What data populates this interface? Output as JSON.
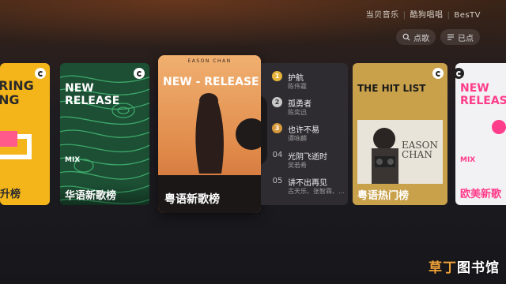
{
  "header": {
    "brand_1": "当贝音乐",
    "brand_2": "酷狗唱唱",
    "brand_3": "BesTV",
    "search_label": "点歌",
    "queue_label": "已点"
  },
  "cards": [
    {
      "title_lines": [
        "RING",
        "NG"
      ],
      "label": "升榜"
    },
    {
      "title_lines": [
        "NEW",
        "RELEASE"
      ],
      "mix": "MIX",
      "label": "华语新歌榜"
    },
    {
      "artist": "EASON CHAN",
      "title": "NEW - RELEASE",
      "label": "粤语新歌榜"
    },
    {
      "title": "THE HIT LIST",
      "cover_text": [
        "EASON",
        "CHAN"
      ],
      "label": "粤语热门榜"
    },
    {
      "title_lines": [
        "NEW",
        "RELEASE"
      ],
      "mix": "MIX",
      "label": "欧美新歌"
    }
  ],
  "tracks": [
    {
      "rank": "1",
      "title": "护航",
      "artist": "陈伟霆"
    },
    {
      "rank": "2",
      "title": "孤勇者",
      "artist": "陈奕迅"
    },
    {
      "rank": "3",
      "title": "也许不易",
      "artist": "谭咏麟"
    },
    {
      "rank": "04",
      "title": "光阴飞逝时",
      "artist": "吴若希"
    },
    {
      "rank": "05",
      "title": "讲不出再见",
      "artist": "古天乐、张智霖、..."
    }
  ],
  "watermark": {
    "part1": "草丁",
    "part2": "图书馆"
  },
  "colors": {
    "gold": "#e6b43a",
    "silver": "#c9c9c9",
    "bronze": "#d89a3c",
    "accent_pink": "#ff3d8a"
  }
}
